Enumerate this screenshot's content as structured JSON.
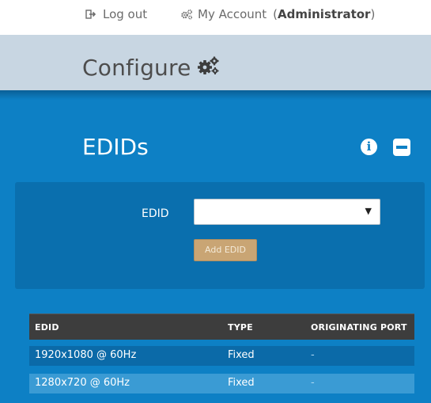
{
  "topbar": {
    "logout_label": "Log out",
    "account_label": "My Account",
    "role_open": "(",
    "role": "Administrator",
    "role_close": ")"
  },
  "header": {
    "title": "Configure"
  },
  "section": {
    "title": "EDIDs",
    "info_glyph": "i"
  },
  "form": {
    "edid_label": "EDID",
    "edid_value": "",
    "select_arrow": "▼",
    "add_button": "Add EDID"
  },
  "table": {
    "headers": [
      "EDID",
      "TYPE",
      "ORIGINATING PORT"
    ],
    "rows": [
      [
        "1920x1080 @ 60Hz",
        "Fixed",
        "-"
      ],
      [
        "1280x720 @ 60Hz",
        "Fixed",
        "-"
      ]
    ]
  },
  "colors": {
    "primary_blue": "#0d80c5",
    "panel_blue": "#0a6fae",
    "header_bg": "#c8d6e2",
    "add_button": "#c9a574",
    "table_header": "#3d3d3d"
  },
  "icons": {
    "logout": "logout-icon",
    "account": "gears-icon",
    "configure": "gears-icon",
    "info": "info-icon",
    "collapse": "minus-square-icon"
  }
}
